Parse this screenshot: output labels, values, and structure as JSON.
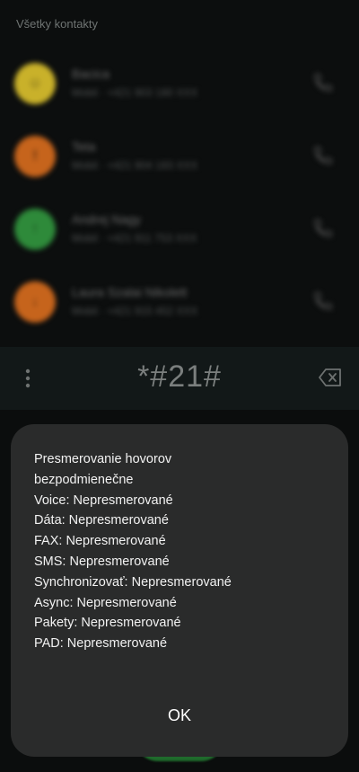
{
  "contacts_list": {
    "section_label": "Všetky kontakty",
    "items": [
      {
        "name": "Bacica",
        "detail": "Mobil · +421 903 180 XXX",
        "avatar_color": "#c9b12a",
        "avatar_glyph": "☺"
      },
      {
        "name": "Teta",
        "detail": "Mobil · +421 904 183 XXX",
        "avatar_color": "#c6641c",
        "avatar_glyph": "!"
      },
      {
        "name": "Andrej Nagy",
        "detail": "Mobil · +421 911 753 XXX",
        "avatar_color": "#2e8a3a",
        "avatar_glyph": "↑"
      },
      {
        "name": "Laura Szalai Nikolett",
        "detail": "Mobil · +421 915 452 XXX",
        "avatar_color": "#c6641c",
        "avatar_glyph": "↓"
      }
    ]
  },
  "dialer": {
    "number": "*#21#"
  },
  "dialog": {
    "lines": [
      "Presmerovanie hovorov",
      "bezpodmienečne",
      "Voice: Nepresmerované",
      "Dáta: Nepresmerované",
      "FAX: Nepresmerované",
      "SMS: Nepresmerované",
      "Synchronizovať: Nepresmerované",
      "Async: Nepresmerované",
      "Pakety: Nepresmerované",
      "PAD: Nepresmerované"
    ],
    "ok_label": "OK"
  },
  "icons": {
    "call": "phone-icon",
    "menu": "more-vertical-icon",
    "backspace": "backspace-icon"
  },
  "colors": {
    "dialog_bg": "#2a2b2b",
    "call_button": "#1f6b2c"
  }
}
